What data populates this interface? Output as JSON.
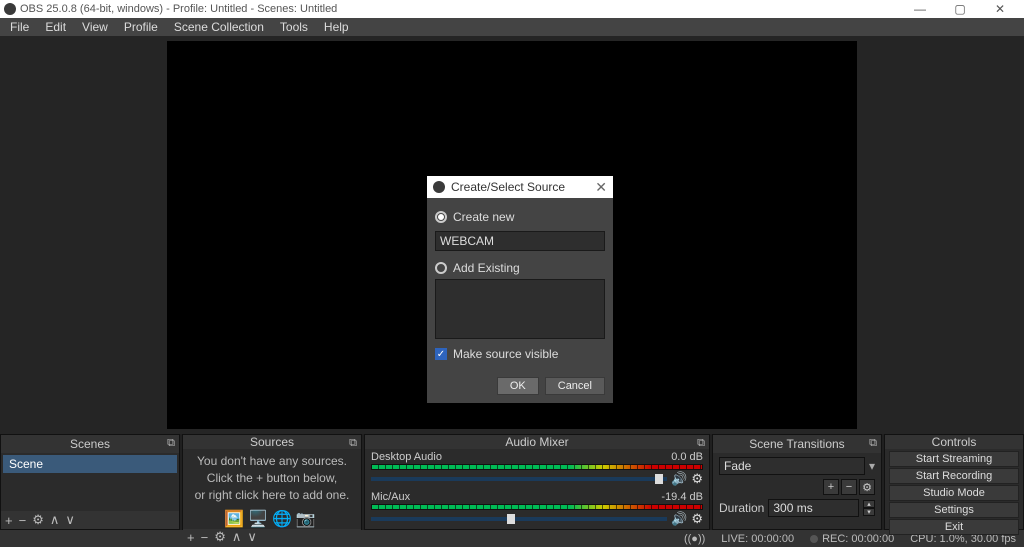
{
  "window": {
    "title": "OBS 25.0.8 (64-bit, windows) - Profile: Untitled - Scenes: Untitled"
  },
  "menu": [
    "File",
    "Edit",
    "View",
    "Profile",
    "Scene Collection",
    "Tools",
    "Help"
  ],
  "dialog": {
    "title": "Create/Select Source",
    "create_new": "Create new",
    "name_value": "WEBCAM",
    "add_existing": "Add Existing",
    "make_visible": "Make source visible",
    "ok": "OK",
    "cancel": "Cancel"
  },
  "docks": {
    "scenes": {
      "title": "Scenes",
      "items": [
        "Scene"
      ]
    },
    "sources": {
      "title": "Sources",
      "empty1": "You don't have any sources.",
      "empty2": "Click the + button below,",
      "empty3": "or right click here to add one."
    },
    "mixer": {
      "title": "Audio Mixer",
      "channels": [
        {
          "name": "Desktop Audio",
          "db": "0.0 dB",
          "thumb_pct": 96
        },
        {
          "name": "Mic/Aux",
          "db": "-19.4 dB",
          "thumb_pct": 46
        }
      ]
    },
    "transitions": {
      "title": "Scene Transitions",
      "selected": "Fade",
      "duration_label": "Duration",
      "duration_value": "300 ms"
    },
    "controls": {
      "title": "Controls",
      "buttons": [
        "Start Streaming",
        "Start Recording",
        "Studio Mode",
        "Settings",
        "Exit"
      ]
    }
  },
  "status": {
    "live": "LIVE: 00:00:00",
    "rec": "REC: 00:00:00",
    "cpu": "CPU: 1.0%, 30.00 fps"
  }
}
